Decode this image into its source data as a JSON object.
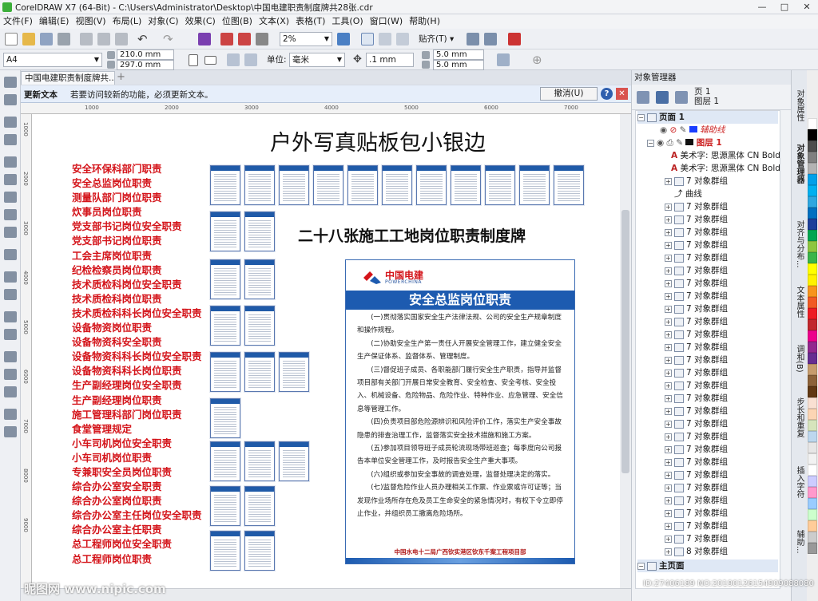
{
  "window": {
    "title": "CorelDRAW X7 (64-Bit) - C:\\Users\\Administrator\\Desktop\\中国电建职责制度牌共28张.cdr"
  },
  "menu": [
    "文件(F)",
    "编辑(E)",
    "视图(V)",
    "布局(L)",
    "对象(C)",
    "效果(C)",
    "位图(B)",
    "文本(X)",
    "表格(T)",
    "工具(O)",
    "窗口(W)",
    "帮助(H)"
  ],
  "toolbar": {
    "zoom": "2%",
    "snap_label": "贴齐(T)"
  },
  "property_bar": {
    "page_size": "A4",
    "width": "210.0 mm",
    "height": "297.0 mm",
    "units_label": "单位:",
    "units_value": "毫米",
    "nudge": ".1 mm",
    "dup_x": "5.0 mm",
    "dup_y": "5.0 mm"
  },
  "doc_tab": {
    "label": "中国电建职责制度牌共..."
  },
  "infobar": {
    "title": "更新文本",
    "message": "若要访问较新的功能，必须更新文本。",
    "cancel": "撤消(U)",
    "help": "?",
    "close": "✕"
  },
  "ruler": {
    "h": [
      "1000",
      "2000",
      "3000",
      "4000",
      "5000",
      "6000",
      "7000"
    ],
    "v": [
      "1000",
      "2000",
      "3000",
      "4000",
      "5000",
      "6000",
      "7000",
      "8000",
      "9000"
    ]
  },
  "canvas": {
    "main_title": "户外写真贴板包小银边",
    "subtitle": "二十八张施工工地岗位职责制度牌",
    "list": [
      "安全环保科部门职责",
      "安全总监岗位职责",
      "测量队部门岗位职责",
      "炊事员岗位职责",
      "党支部书记岗位安全职责",
      "党支部书记岗位职责",
      "工会主席岗位职责",
      "纪检检察员岗位职责",
      "技术质检科岗位安全职责",
      "技术质检科岗位职责",
      "技术质检科科长岗位安全职责",
      "设备物资岗位职责",
      "设备物资科安全职责",
      "设备物资科科长岗位安全职责",
      "设备物资科科长岗位职责",
      "生产副经理岗位安全职责",
      "生产副经理岗位职责",
      "施工管理科部门岗位职责",
      "食堂管理规定",
      "小车司机岗位安全职责",
      "小车司机岗位职责",
      "专兼职安全员岗位职责",
      "综合办公室安全职责",
      "综合办公室岗位职责",
      "综合办公室主任岗位安全职责",
      "综合办公室主任职责",
      "总工程师岗位安全职责",
      "总工程师岗位职责"
    ]
  },
  "board": {
    "brand": "中国电建",
    "brand_en": "POWERCHINA",
    "title": "安全总监岗位职责",
    "paragraphs": [
      "(一)贯彻落实国家安全生产法律法规、公司的安全生产规章制度和操作规程。",
      "(二)协助安全生产第一责任人开展安全管理工作，建立健全安全生产保证体系、监督体系、管理制度。",
      "(三)督促班子成员、各职能部门履行安全生产职责，指导并监督项目部有关部门开展日常安全教育、安全检查、安全考核、安全投入、机械设备、危险物品、危险作业、特种作业、应急管理、安全信息等管理工作。",
      "(四)负责项目部危险源辨识和风险评价工作，落实生产安全事故隐患的排查治理工作，监督落实安全技术措施和施工方案。",
      "(五)参加项目领导班子成员轮流现场带班巡查；每季度向公司报告本单位安全管理工作，及时报告安全生产重大事项。",
      "(六)组织或参加安全事故的调查处理，监督处理决定的落实。",
      "(七)监督危险作业人员办理相关工作票、作业票或许可证等；当发现作业场所存在危及员工生命安全的紧急情况时，有权下令立即停止作业，并组织员工撤离危险场所。"
    ],
    "footer": "中国水电十二局广西钦实港区钦东千案工程项目部"
  },
  "object_manager": {
    "header": "对象管理器",
    "page_line1": "页 1",
    "page_line2": "图层 1",
    "page": "页面 1",
    "guides": "辅助线",
    "layer": "图层 1",
    "text1": "美术字: 思源黑体 CN Bold (",
    "text2": "美术字: 思源黑体 CN Bold (",
    "group7": "7 对象群组",
    "curve": "曲线",
    "group8": "8 对象群组",
    "master": "主页面"
  },
  "side_tabs": [
    "对象属性",
    "对象管理器",
    "对齐与分布...",
    "文本属性",
    "调和(B)",
    "步长和重复",
    "插入字符",
    "辅助..."
  ],
  "palette": [
    "#ffffff",
    "#000000",
    "#4d4d4d",
    "#808080",
    "#b3b3b3",
    "#00a0e9",
    "#00b0f0",
    "#2ea7e0",
    "#0070c0",
    "#1d3f9a",
    "#00a651",
    "#8dc63f",
    "#39b54a",
    "#ffff00",
    "#fff200",
    "#f7941d",
    "#f15a24",
    "#ed1c24",
    "#c1272d",
    "#ec008c",
    "#92278f",
    "#662d91",
    "#c69c6d",
    "#8c6239",
    "#603813",
    "#f9e0d2",
    "#fcd5b4",
    "#d6e4bc",
    "#bdd7ee",
    "#e7e6e6",
    "#f2f2f2",
    "#ffffff",
    "#ccccff",
    "#ff99cc",
    "#99ccff",
    "#ccffcc",
    "#ffcc99",
    "#cccccc",
    "#999999"
  ],
  "watermark": {
    "left": "昵图网 www.nipic.com",
    "right": "ID:27406189 NO:20190126154909088080"
  }
}
